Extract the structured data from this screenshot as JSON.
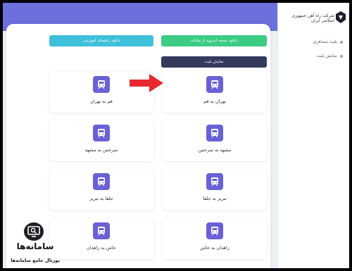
{
  "sidebar": {
    "logo_text": "شرکت راه آهن جمهوری اسلامی ایران",
    "items": [
      {
        "label": "بلیت مسافری"
      },
      {
        "label": "نمایش بلیت"
      }
    ]
  },
  "toolbar": {
    "download_tutorial_label": "دانلود راهنمای آموزشی",
    "download_android_label": "دانلود نسخه اندروید از مایکت",
    "show_ticket_label": "نمایش بلیت"
  },
  "routes": [
    {
      "label": "تهران به قم"
    },
    {
      "label": "قم به تهران"
    },
    {
      "label": "مشهد به سرخس"
    },
    {
      "label": "سرخس به مشهد"
    },
    {
      "label": "تبریز به جلفا"
    },
    {
      "label": "جلفا به تبریز"
    },
    {
      "label": "زاهدان به خاش"
    },
    {
      "label": "خاش به زاهدان"
    }
  ],
  "watermark": {
    "title": "سامانه‌ها",
    "subtitle": "پورتال جامع سامانه‌ها"
  },
  "colors": {
    "accent": "#6c6fdc",
    "icon_bg": "#6a61d6",
    "teal": "#3ec0da",
    "green": "#3ccc84",
    "dark": "#353a5d",
    "arrow": "#e8292f"
  }
}
